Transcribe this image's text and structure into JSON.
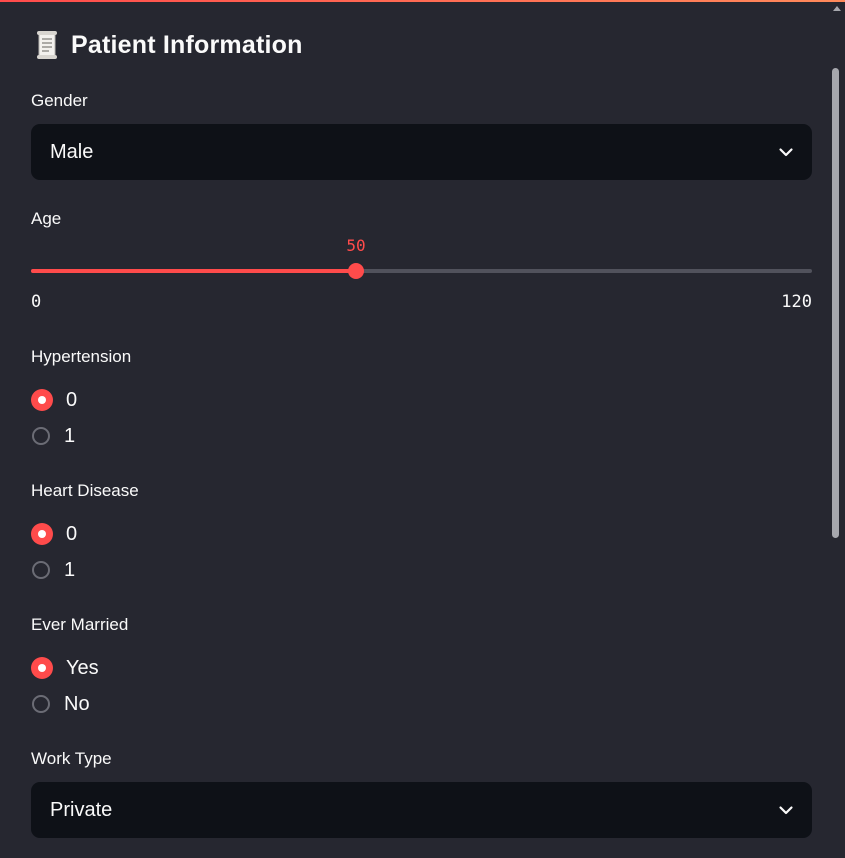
{
  "header": {
    "icon": "scroll-icon",
    "title": "Patient Information"
  },
  "gender": {
    "label": "Gender",
    "selected": "Male",
    "icon": "chevron-down-icon"
  },
  "age": {
    "label": "Age",
    "value": 50,
    "value_text": "50",
    "min": 0,
    "max": 120,
    "min_text": "0",
    "max_text": "120"
  },
  "hypertension": {
    "label": "Hypertension",
    "options": [
      "0",
      "1"
    ],
    "selected": "0"
  },
  "heart_disease": {
    "label": "Heart Disease",
    "options": [
      "0",
      "1"
    ],
    "selected": "0"
  },
  "ever_married": {
    "label": "Ever Married",
    "options": [
      "Yes",
      "No"
    ],
    "selected": "Yes"
  },
  "work_type": {
    "label": "Work Type",
    "selected": "Private",
    "icon": "chevron-down-icon"
  },
  "colors": {
    "background": "#262730",
    "input_background": "#0e1117",
    "accent": "#ff4b4b",
    "text": "#fafafa",
    "slider_track": "#51525c"
  }
}
